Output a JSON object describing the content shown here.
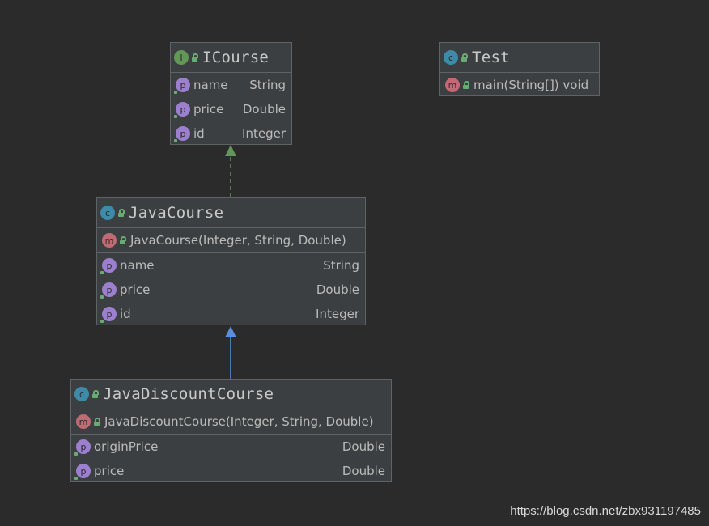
{
  "colors": {
    "background": "#2b2b2b",
    "box": "#3c3f41",
    "implements_arrow": "#629755",
    "extends_arrow": "#5a8fde"
  },
  "classes": {
    "icourse": {
      "kind": "interface",
      "icon_letter": "I",
      "name": "ICourse",
      "fields": [
        {
          "name": "name",
          "type": "String"
        },
        {
          "name": "price",
          "type": "Double"
        },
        {
          "name": "id",
          "type": "Integer"
        }
      ]
    },
    "test": {
      "kind": "class",
      "icon_letter": "c",
      "name": "Test",
      "methods": [
        {
          "signature": "main(String[]) void"
        }
      ]
    },
    "javacourse": {
      "kind": "class",
      "icon_letter": "c",
      "name": "JavaCourse",
      "constructors": [
        {
          "signature": "JavaCourse(Integer, String, Double)"
        }
      ],
      "fields": [
        {
          "name": "name",
          "type": "String"
        },
        {
          "name": "price",
          "type": "Double"
        },
        {
          "name": "id",
          "type": "Integer"
        }
      ]
    },
    "javadiscountcourse": {
      "kind": "class",
      "icon_letter": "c",
      "name": "JavaDiscountCourse",
      "constructors": [
        {
          "signature": "JavaDiscountCourse(Integer, String, Double)"
        }
      ],
      "fields": [
        {
          "name": "originPrice",
          "type": "Double"
        },
        {
          "name": "price",
          "type": "Double"
        }
      ]
    }
  },
  "icons": {
    "member_method_letter": "m",
    "member_property_letter": "p"
  },
  "relations": [
    {
      "from": "JavaCourse",
      "to": "ICourse",
      "type": "implements"
    },
    {
      "from": "JavaDiscountCourse",
      "to": "JavaCourse",
      "type": "extends"
    }
  ],
  "watermark": "https://blog.csdn.net/zbx931197485"
}
